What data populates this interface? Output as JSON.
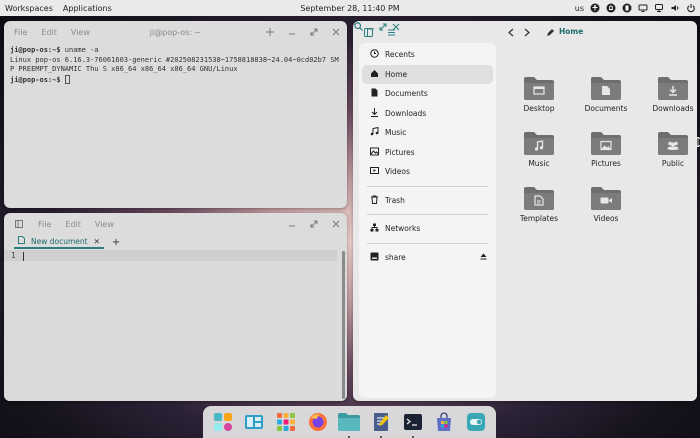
{
  "topbar": {
    "workspaces": "Workspaces",
    "applications": "Applications",
    "datetime": "September 28, 11:40 PM",
    "keyboard": "us"
  },
  "terminal": {
    "menu": [
      "File",
      "Edit",
      "View"
    ],
    "title": "ji@pop-os: ~",
    "prompt1": "ji@pop-os:~$",
    "command": " uname -a",
    "output": "Linux pop-os 6.16.3-76061603-generic #202508231538~1758818838~24.04~0cd02b7 SMP PREEMPT_DYNAMIC Thu S x86_64 x86_64 x86_64 GNU/Linux",
    "prompt2": "ji@pop-os:~$"
  },
  "editor": {
    "menu": [
      "File",
      "Edit",
      "View"
    ],
    "tab_label": "New document",
    "line_number": "1"
  },
  "files": {
    "location": "Home",
    "sidebar": [
      {
        "label": "Recents",
        "icon": "clock-icon"
      },
      {
        "label": "Home",
        "icon": "home-icon",
        "active": true
      },
      {
        "label": "Documents",
        "icon": "document-icon"
      },
      {
        "label": "Downloads",
        "icon": "download-icon"
      },
      {
        "label": "Music",
        "icon": "music-icon"
      },
      {
        "label": "Pictures",
        "icon": "image-icon"
      },
      {
        "label": "Videos",
        "icon": "video-icon"
      },
      {
        "label": "Trash",
        "icon": "trash-icon"
      },
      {
        "label": "Networks",
        "icon": "network-icon"
      },
      {
        "label": "share",
        "icon": "drive-icon"
      }
    ],
    "folders": [
      "Desktop",
      "Documents",
      "Downloads",
      "Music",
      "Pictures",
      "Public",
      "Templates",
      "Videos"
    ]
  },
  "colors": {
    "accent": "#2d7f7f",
    "folder": "#6e6e6e"
  }
}
